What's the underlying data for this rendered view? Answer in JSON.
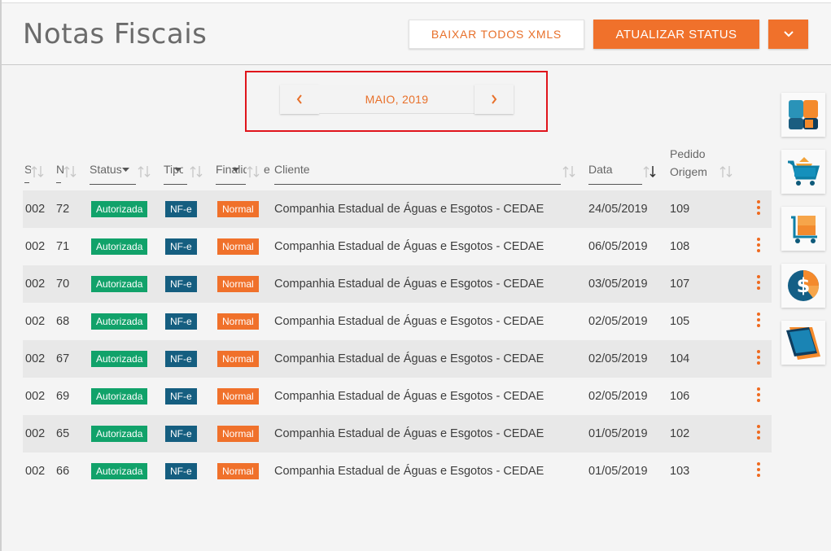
{
  "header": {
    "title": "Notas Fiscais",
    "download_label": "BAIXAR TODOS XMLS",
    "update_label": "ATUALIZAR STATUS",
    "more_icon": "chevron-down-icon"
  },
  "month_nav": {
    "label": "MAIO, 2019",
    "prev_icon": "chevron-left-icon",
    "next_icon": "chevron-right-icon"
  },
  "columns": {
    "serie": "S",
    "numero": "N",
    "status": "Status",
    "tipo": "Tipo",
    "finalidade": "Finalid",
    "cliente_prefix": "e",
    "cliente": "Cliente",
    "data": "Data",
    "pedido_line1": "Pedido",
    "pedido_line2": "Origem"
  },
  "rows": [
    {
      "serie": "002",
      "numero": "72",
      "status": "Autorizada",
      "tipo": "NF-e",
      "finalidade": "Normal",
      "cliente": "Companhia Estadual de Águas e Esgotos - CEDAE",
      "data": "24/05/2019",
      "pedido": "109"
    },
    {
      "serie": "002",
      "numero": "71",
      "status": "Autorizada",
      "tipo": "NF-e",
      "finalidade": "Normal",
      "cliente": "Companhia Estadual de Águas e Esgotos - CEDAE",
      "data": "06/05/2019",
      "pedido": "108"
    },
    {
      "serie": "002",
      "numero": "70",
      "status": "Autorizada",
      "tipo": "NF-e",
      "finalidade": "Normal",
      "cliente": "Companhia Estadual de Águas e Esgotos - CEDAE",
      "data": "03/05/2019",
      "pedido": "107"
    },
    {
      "serie": "002",
      "numero": "68",
      "status": "Autorizada",
      "tipo": "NF-e",
      "finalidade": "Normal",
      "cliente": "Companhia Estadual de Águas e Esgotos - CEDAE",
      "data": "02/05/2019",
      "pedido": "105"
    },
    {
      "serie": "002",
      "numero": "67",
      "status": "Autorizada",
      "tipo": "NF-e",
      "finalidade": "Normal",
      "cliente": "Companhia Estadual de Águas e Esgotos - CEDAE",
      "data": "02/05/2019",
      "pedido": "104"
    },
    {
      "serie": "002",
      "numero": "69",
      "status": "Autorizada",
      "tipo": "NF-e",
      "finalidade": "Normal",
      "cliente": "Companhia Estadual de Águas e Esgotos - CEDAE",
      "data": "02/05/2019",
      "pedido": "106"
    },
    {
      "serie": "002",
      "numero": "65",
      "status": "Autorizada",
      "tipo": "NF-e",
      "finalidade": "Normal",
      "cliente": "Companhia Estadual de Águas e Esgotos - CEDAE",
      "data": "01/05/2019",
      "pedido": "102"
    },
    {
      "serie": "002",
      "numero": "66",
      "status": "Autorizada",
      "tipo": "NF-e",
      "finalidade": "Normal",
      "cliente": "Companhia Estadual de Águas e Esgotos - CEDAE",
      "data": "01/05/2019",
      "pedido": "103"
    }
  ],
  "side_icons": [
    "dashboard-icon",
    "shopping-cart-icon",
    "box-cart-icon",
    "dollar-icon",
    "layers-icon"
  ],
  "colors": {
    "accent": "#f0712b",
    "status_green": "#11a26a",
    "tipo_blue": "#155e80",
    "highlight_red": "#e0141b"
  }
}
